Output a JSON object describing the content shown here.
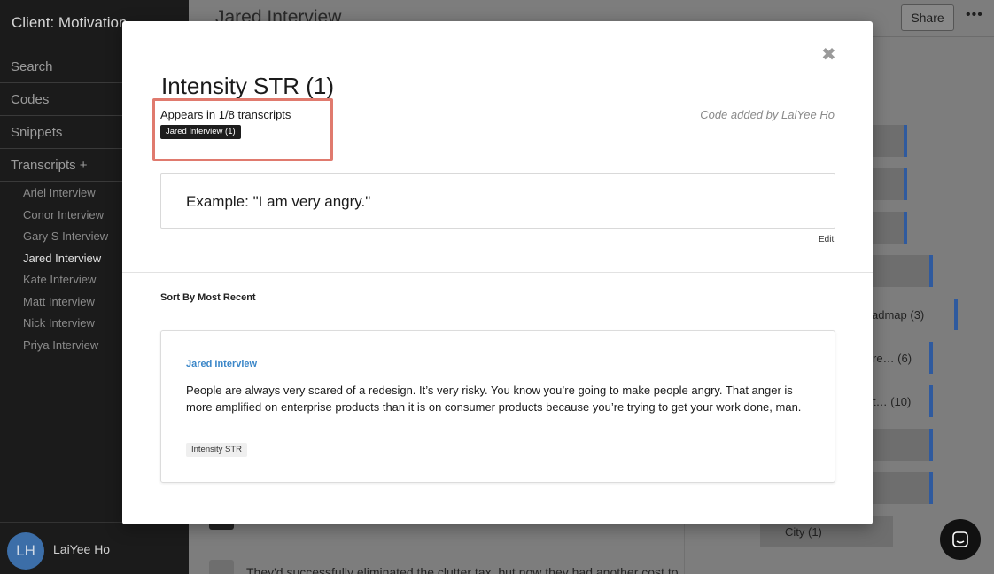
{
  "sidebar": {
    "client": "Client: Motivation",
    "sections": {
      "search": "Search",
      "codes": "Codes",
      "snippets": "Snippets",
      "transcripts": "Transcripts +"
    },
    "transcripts": [
      {
        "label": "Ariel Interview"
      },
      {
        "label": "Conor Interview"
      },
      {
        "label": "Gary S Interview"
      },
      {
        "label": "Jared Interview"
      },
      {
        "label": "Kate Interview"
      },
      {
        "label": "Matt Interview"
      },
      {
        "label": "Nick Interview"
      },
      {
        "label": "Priya Interview"
      }
    ],
    "user": {
      "initials": "LH",
      "name": "LaiYee Ho"
    }
  },
  "header": {
    "title": "Jared Interview",
    "share_label": "Share",
    "more_label": "•••"
  },
  "background": {
    "code_bars": [
      {
        "text": ""
      },
      {
        "text": ""
      },
      {
        "text": ""
      },
      {
        "text": ""
      },
      {
        "text": "admap (3)"
      },
      {
        "text": "re…  (6)"
      },
      {
        "text": "t…  (10)"
      },
      {
        "text": ""
      },
      {
        "text": ""
      },
      {
        "text": "City (1)"
      }
    ],
    "transcript_line": "They'd successfully eliminated the clutter tax, but now they had another cost to"
  },
  "modal": {
    "close": "✖",
    "title": "Intensity STR (1)",
    "appears_in": "Appears in 1/8 transcripts",
    "transcript_chip": "Jared Interview (1)",
    "added_by": "Code added by LaiYee Ho",
    "example": "Example: \"I am very angry.\"",
    "edit_label": "Edit",
    "sort_label": "Sort By Most Recent",
    "snippets": [
      {
        "source": "Jared Interview",
        "text": "People are always very scared of a redesign. It’s very risky. You know you’re going to make people angry. That anger is more amplified on enterprise products than it is on consumer products because you’re trying to get your work done, man.",
        "tag": "Intensity STR"
      }
    ]
  },
  "colors": {
    "accent_blue": "#3a86c8",
    "highlight_red": "#e07a6e",
    "bar_accent": "#2f5a9e"
  },
  "icons": {
    "close": "close-icon",
    "more": "more-icon",
    "chat": "chat-icon"
  }
}
